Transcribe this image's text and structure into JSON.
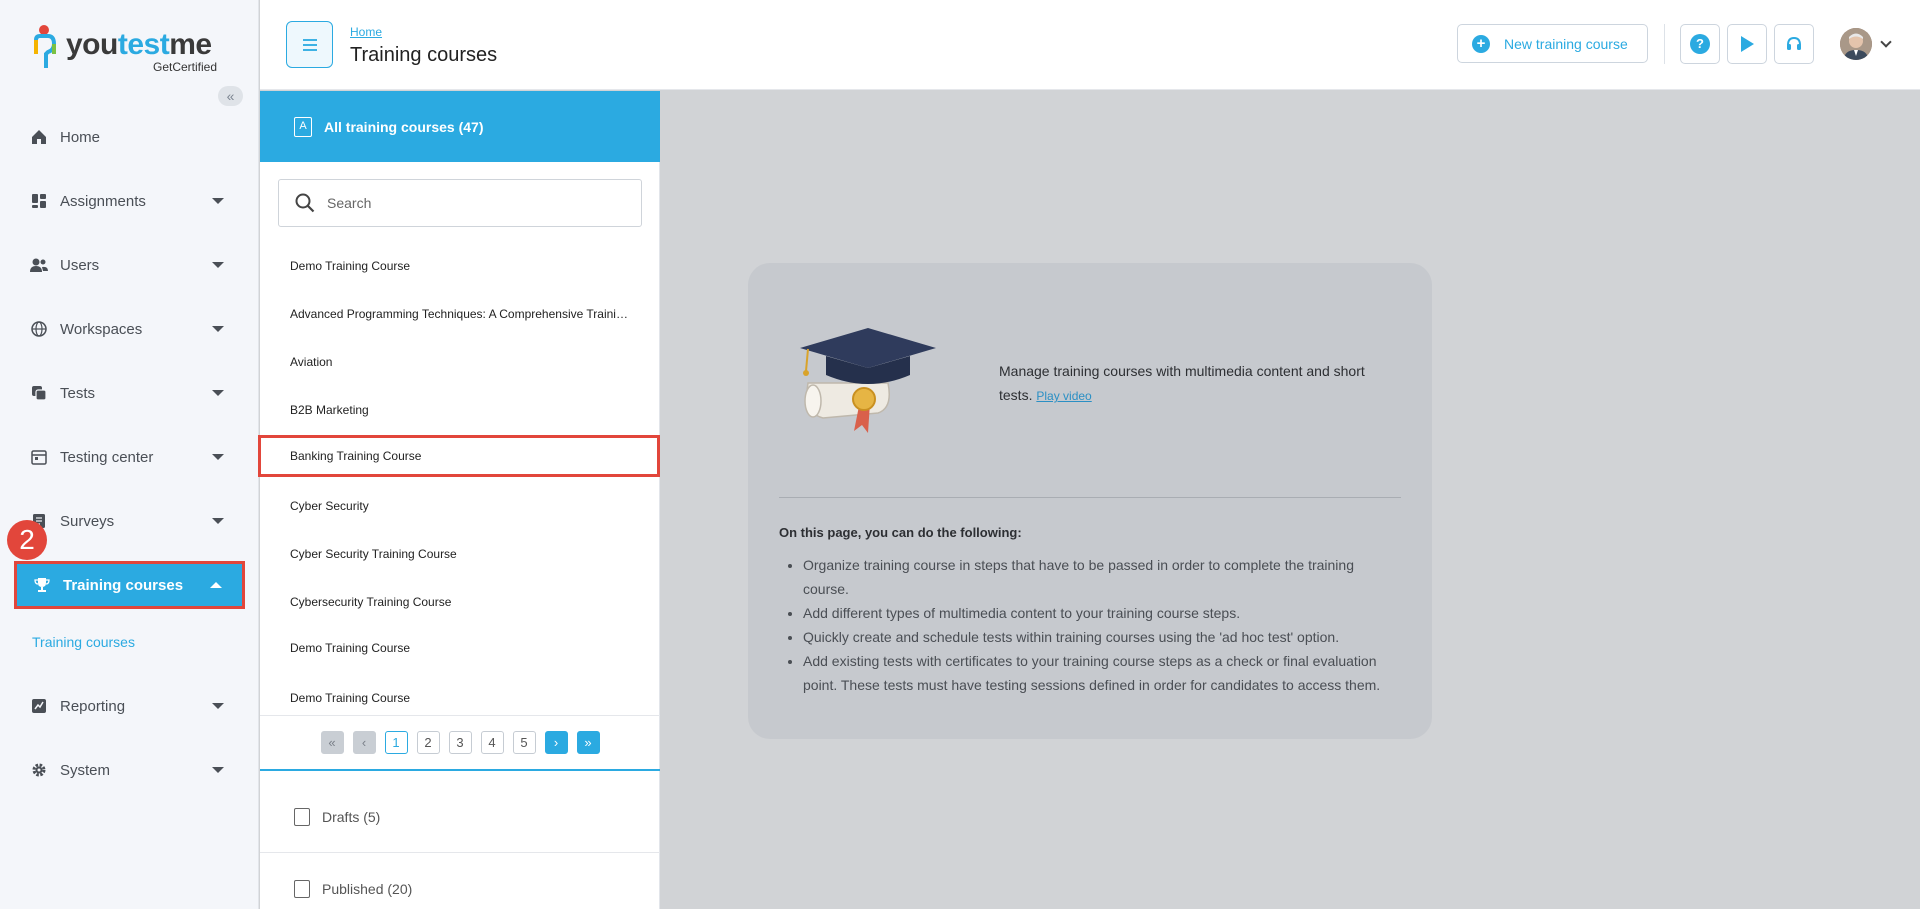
{
  "brand": {
    "word_a": "you",
    "word_b": "test",
    "word_c": "me",
    "sub": "GetCertified"
  },
  "sidebar": {
    "collapse_glyph": "«",
    "items": [
      {
        "label": "Home",
        "icon": "home-icon",
        "has_caret": false
      },
      {
        "label": "Assignments",
        "icon": "dashboard-icon",
        "has_caret": true
      },
      {
        "label": "Users",
        "icon": "users-icon",
        "has_caret": true
      },
      {
        "label": "Workspaces",
        "icon": "globe-icon",
        "has_caret": true
      },
      {
        "label": "Tests",
        "icon": "copy-icon",
        "has_caret": true
      },
      {
        "label": "Testing center",
        "icon": "calendar-icon",
        "has_caret": true
      },
      {
        "label": "Surveys",
        "icon": "survey-icon",
        "has_caret": true
      },
      {
        "label": "Training courses",
        "icon": "trophy-icon",
        "has_caret": true,
        "active": true
      },
      {
        "label": "Reporting",
        "icon": "chart-icon",
        "has_caret": true
      },
      {
        "label": "System",
        "icon": "gear-icon",
        "has_caret": true
      }
    ],
    "sub_item": "Training courses",
    "step_badge": "2"
  },
  "header": {
    "breadcrumb": "Home",
    "title": "Training courses",
    "new_button": "New training course",
    "help_icon": "?"
  },
  "panel": {
    "head": "All training courses (47)",
    "search_placeholder": "Search",
    "items": [
      "Demo Training Course",
      "Advanced Programming Techniques: A Comprehensive Training Course",
      "Aviation",
      "B2B Marketing",
      "Banking Training Course",
      "Cyber Security",
      "Cyber Security Training Course",
      "Cybersecurity Training Course",
      "Demo Training Course",
      "Demo Training Course"
    ],
    "selected_index": 4,
    "pages": [
      "1",
      "2",
      "3",
      "4",
      "5"
    ],
    "current_page": "1",
    "categories": [
      "Drafts (5)",
      "Published (20)"
    ]
  },
  "card": {
    "intro": "Manage training courses with multimedia content and short tests.",
    "video_link": "Play video",
    "subtitle": "On this page, you can do the following:",
    "bullets": [
      "Organize training course in steps that have to be passed in order to complete the training course.",
      "Add different types of multimedia content to your training course steps.",
      "Quickly create and schedule tests within training courses using the 'ad hoc test' option.",
      "Add existing tests with certificates to your training course steps as a check or final evaluation point. These tests must have testing sessions defined in order for candidates to access them."
    ]
  },
  "colors": {
    "accent": "#2baae1",
    "highlight": "#e2463b"
  }
}
